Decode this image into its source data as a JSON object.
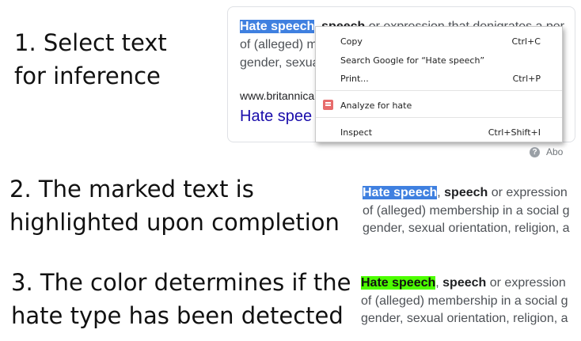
{
  "steps": {
    "step1": [
      "1. Select text",
      "for inference"
    ],
    "step2": [
      "2. The marked text is",
      "highlighted upon completion"
    ],
    "step3": [
      "3. The color determines if the",
      "hate type has been detected"
    ]
  },
  "snippet": {
    "selected": "Hate speech",
    "bold_word": "speech",
    "line1_rest": " or expression that denigrates a per",
    "line1_rest_short": " or expression",
    "line2": "of (alleged) membership in a social g",
    "line3": "gender, sexual orientation, religion, a"
  },
  "card": {
    "line2_visible": "of (alleged) m",
    "line3_visible": "gender, sexual",
    "url": "www.britannica",
    "title_link": "Hate spee"
  },
  "context_menu": {
    "items": [
      {
        "label": "Copy",
        "shortcut": "Ctrl+C"
      },
      {
        "label": "Search Google for “Hate speech”",
        "shortcut": ""
      },
      {
        "label": "Print...",
        "shortcut": "Ctrl+P"
      },
      {
        "label": "Analyze for hate",
        "shortcut": "",
        "icon": "extension-icon"
      },
      {
        "label": "Inspect",
        "shortcut": "Ctrl+Shift+I"
      }
    ]
  },
  "about": {
    "text": "Abo",
    "icon": "?"
  },
  "colors": {
    "selection_blue": "#3f80e0",
    "highlight_green": "#4cff00",
    "link_blue": "#1a0dab"
  }
}
